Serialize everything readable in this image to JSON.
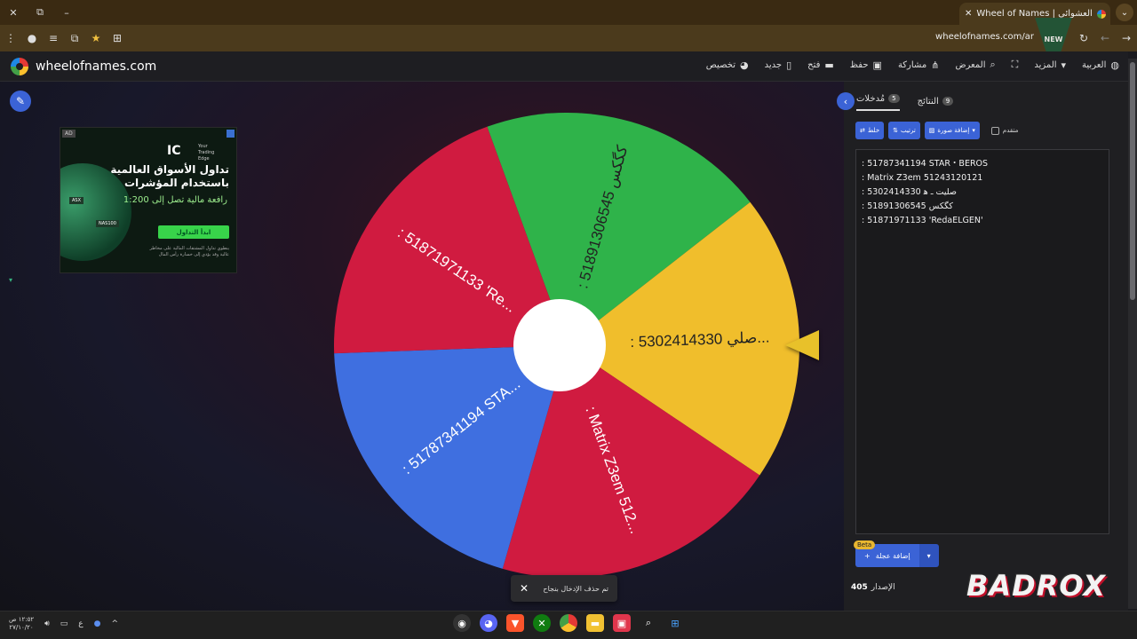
{
  "browser": {
    "tab_title": "Wheel of Names | العشوائي",
    "url": "wheelofnames.com/ar",
    "window_min": "–",
    "window_restore": "⧉",
    "window_close": "✕",
    "new_tab": "+",
    "tab_close": "✕",
    "tab_menu": "⌄"
  },
  "site": {
    "brand": "wheelofnames.com",
    "menu": [
      {
        "label": "العربية",
        "icon": "globe-icon"
      },
      {
        "label": "المزيد",
        "icon": "chevron-down-icon"
      },
      {
        "label": "",
        "icon": "fullscreen-icon"
      },
      {
        "label": "المعرض",
        "icon": "search-icon"
      },
      {
        "label": "مشاركة",
        "icon": "share-icon"
      },
      {
        "label": "حفظ",
        "icon": "save-icon"
      },
      {
        "label": "فتح",
        "icon": "folder-icon"
      },
      {
        "label": "جديد",
        "icon": "file-icon"
      },
      {
        "label": "تخصيص",
        "icon": "palette-icon"
      }
    ]
  },
  "ad": {
    "tag": "AD",
    "logo": "IC",
    "logo_sub": "Your Trading Edge",
    "headline": "تداول الأسواق العالمية باستخدام المؤشرات",
    "subheadline": "رافعة مالية تصل إلى 1:200",
    "cta": "ابدأ التداول",
    "fine_print": "ينطوي تداول المشتقات المالية على مخاطر عالية وقد يؤدي إلى خسارة رأس المال",
    "chip1": "ASX",
    "chip2": "NAS100"
  },
  "wheel": {
    "segments": [
      {
        "label": ": 51891306545 كگكس",
        "color": "#2fb34a"
      },
      {
        "label": ": 5302414330 صلي...",
        "color": "#f0be2c"
      },
      {
        "label": ": Matrix Z3em 512...",
        "color": "#d01b40"
      },
      {
        "label": ": 51787341194 STA...",
        "color": "#3f6fe0"
      },
      {
        "label": ": 51871971133 'Re...",
        "color": "#d01b40"
      }
    ],
    "accent_red": "#d01b40",
    "accent_green": "#2fb34a",
    "accent_yellow": "#f0be2c",
    "accent_blue": "#3f6fe0"
  },
  "toast": {
    "message": "تم حذف الإدخال بنجاح",
    "close": "✕"
  },
  "panel": {
    "tab_entries_label": "مُدخلات",
    "tab_entries_count": "5",
    "tab_results_label": "النتائج",
    "tab_results_count": "9",
    "shuffle_label": "خلط",
    "sort_label": "ترتيب",
    "add_image_label": "إضافة صورة",
    "advanced_label": "متقدم",
    "entries": [
      ": 51787341194 STAR・BEROS",
      ": Matrix Z3em 51243120121",
      ": 5302414330 صليت ـ ﮬ",
      ": 51891306545 كگكس",
      ": 51871971133 'RedaELGEN'"
    ],
    "beta": "Beta",
    "add_wheel_label": "إضافة عجلة",
    "version_label": "الإصدار",
    "version_number": "405"
  },
  "watermark": "BADROX",
  "taskbar": {
    "time": "١٢:٥٢ ص",
    "date": "٢٧/١٠/٢٠",
    "lang": "ع"
  }
}
